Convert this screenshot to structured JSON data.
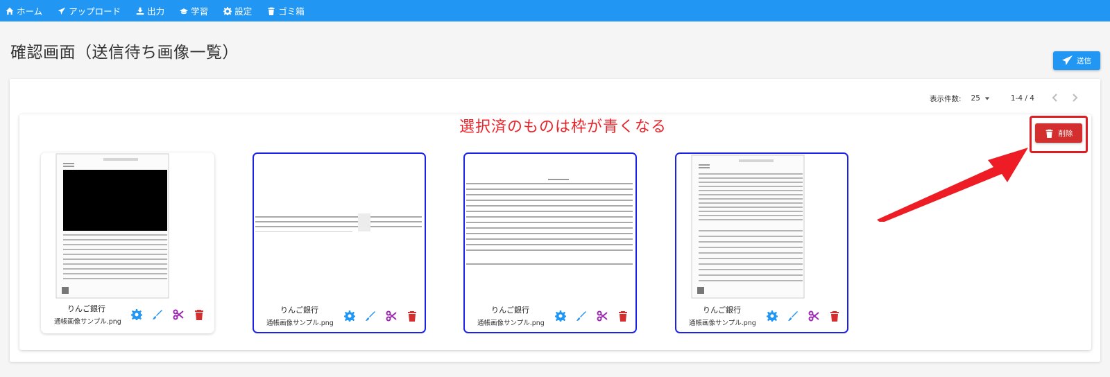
{
  "nav": [
    {
      "label": "ホーム",
      "icon": "home-icon"
    },
    {
      "label": "アップロード",
      "icon": "send-icon"
    },
    {
      "label": "出力",
      "icon": "download-icon"
    },
    {
      "label": "学習",
      "icon": "graduation-cap-icon"
    },
    {
      "label": "設定",
      "icon": "gear-icon"
    },
    {
      "label": "ゴミ箱",
      "icon": "trash-icon"
    }
  ],
  "page": {
    "title": "確認画面（送信待ち画像一覧）"
  },
  "toolbar": {
    "send_label": "送信",
    "delete_label": "削除"
  },
  "pagination": {
    "per_page_label": "表示件数:",
    "per_page_value": "25",
    "range": "1-4 / 4"
  },
  "annotation": {
    "text": "選択済のものは枠が青くなる",
    "color": "#e8242a"
  },
  "colors": {
    "primary": "#2196f3",
    "danger": "#d32f2f",
    "selected_border": "#1e22e8",
    "edit": "#2196f3",
    "crop": "#9c27b0"
  },
  "cards": [
    {
      "bank": "りんご銀行",
      "file": "通帳画像サンプル.png",
      "selected": false
    },
    {
      "bank": "りんご銀行",
      "file": "通帳画像サンプル.png",
      "selected": true
    },
    {
      "bank": "りんご銀行",
      "file": "通帳画像サンプル.png",
      "selected": true
    },
    {
      "bank": "りんご銀行",
      "file": "通帳画像サンプル.png",
      "selected": true
    }
  ]
}
